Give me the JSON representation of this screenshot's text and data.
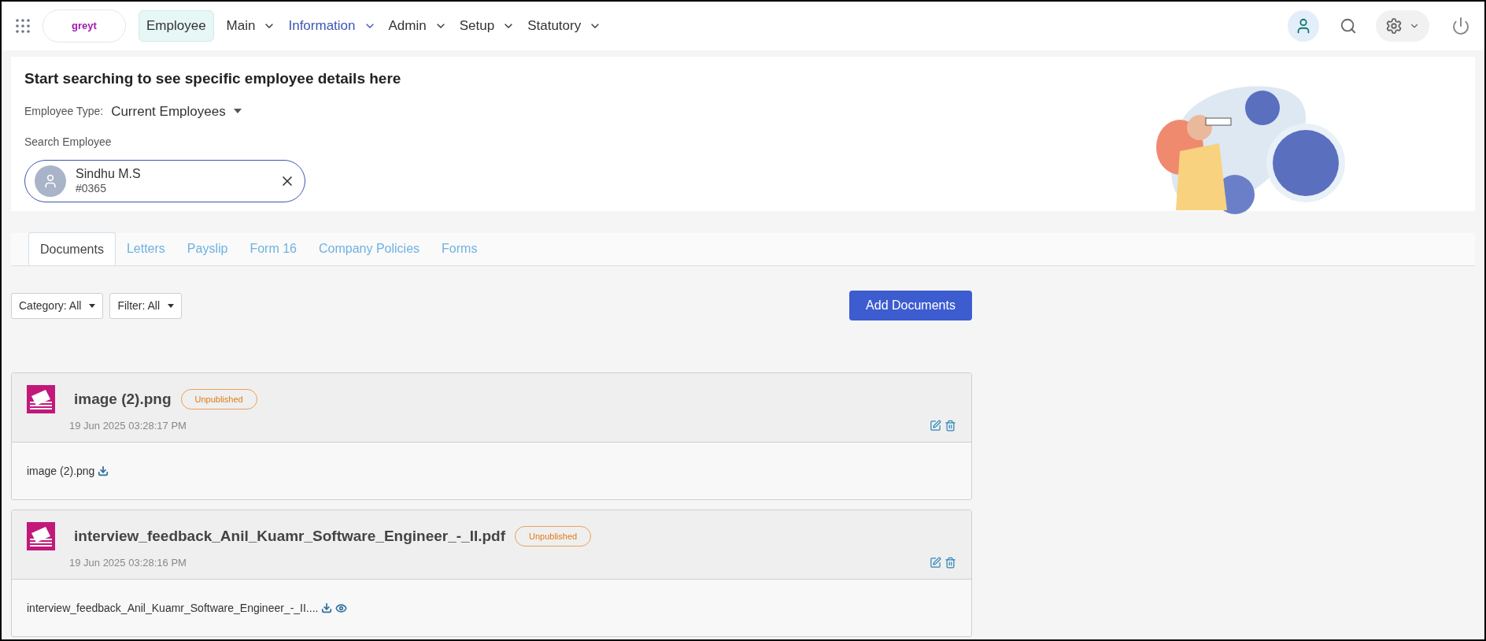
{
  "nav": {
    "logo": "greyt",
    "module": "Employee",
    "menus": [
      {
        "label": "Main",
        "selected": false
      },
      {
        "label": "Information",
        "selected": true
      },
      {
        "label": "Admin",
        "selected": false
      },
      {
        "label": "Setup",
        "selected": false
      },
      {
        "label": "Statutory",
        "selected": false
      }
    ]
  },
  "search_panel": {
    "heading": "Start searching to see specific employee details here",
    "employee_type_label": "Employee Type:",
    "employee_type": "Current Employees",
    "search_label": "Search Employee",
    "employee": {
      "name": "Sindhu M.S",
      "code": "#0365"
    }
  },
  "tabs": [
    {
      "label": "Documents",
      "selected": true
    },
    {
      "label": "Letters",
      "selected": false
    },
    {
      "label": "Payslip",
      "selected": false
    },
    {
      "label": "Form 16",
      "selected": false
    },
    {
      "label": "Company Policies",
      "selected": false
    },
    {
      "label": "Forms",
      "selected": false
    }
  ],
  "filters": [
    "Category: All",
    "Filter: All"
  ],
  "add_button": "Add Documents",
  "documents": [
    {
      "title": "image (2).png",
      "status": "Unpublished",
      "date": "19 Jun 2025 03:28:17 PM",
      "file": "image (2).png",
      "viewable": false
    },
    {
      "title": "interview_feedback_Anil_Kuamr_Software_Engineer_-_II.pdf",
      "status": "Unpublished",
      "date": "19 Jun 2025 03:28:16 PM",
      "file": "interview_feedback_Anil_Kuamr_Software_Engineer_-_II....",
      "viewable": true
    }
  ]
}
